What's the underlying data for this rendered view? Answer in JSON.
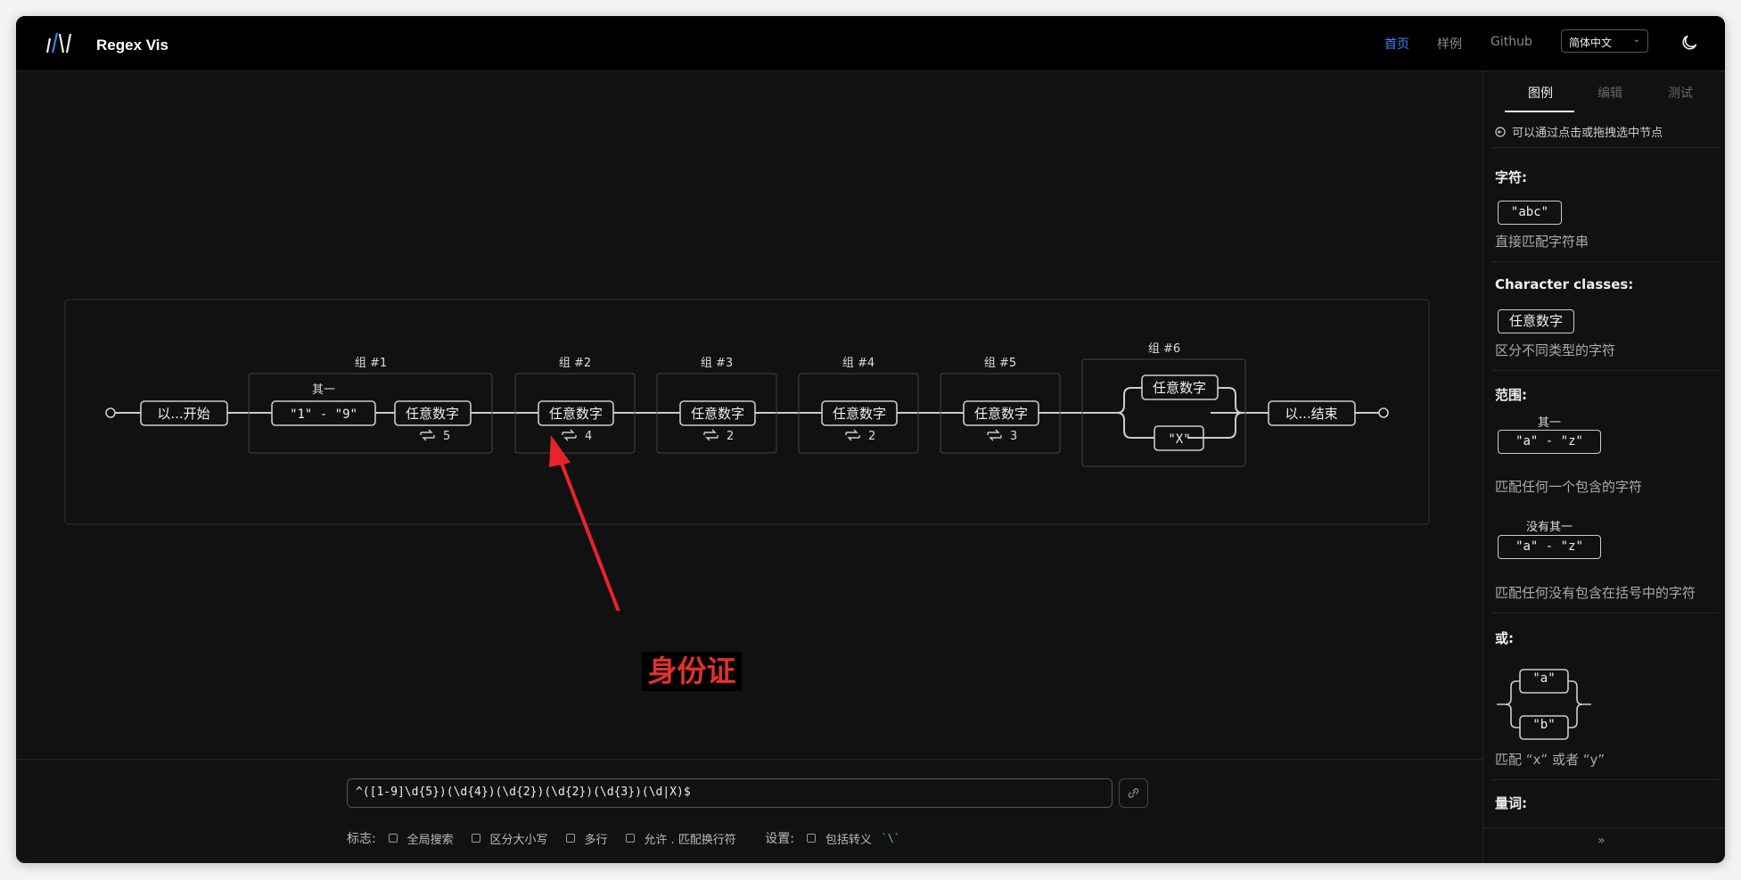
{
  "header": {
    "app_title": "Regex Vis",
    "nav": [
      {
        "label": "首页"
      },
      {
        "label": "样例"
      },
      {
        "label": "Github"
      }
    ],
    "language": "简体中文"
  },
  "diagram": {
    "start_label": "以...开始",
    "end_label": "以...结束",
    "groups": [
      {
        "label": "组 #1",
        "range_caption": "其一",
        "range": "\"1\" - \"9\"",
        "node": "任意数字",
        "quantifier": "5"
      },
      {
        "label": "组 #2",
        "node": "任意数字",
        "quantifier": "4"
      },
      {
        "label": "组 #3",
        "node": "任意数字",
        "quantifier": "2"
      },
      {
        "label": "组 #4",
        "node": "任意数字",
        "quantifier": "2"
      },
      {
        "label": "组 #5",
        "node": "任意数字",
        "quantifier": "3"
      },
      {
        "label": "组 #6",
        "alt_top": "任意数字",
        "alt_bottom": "\"X\""
      }
    ]
  },
  "annotation": {
    "text": "身份证"
  },
  "regex": {
    "value": "^([1-9]\\d{5})(\\d{4})(\\d{2})(\\d{2})(\\d{3})(\\d|X)$"
  },
  "flags": {
    "label": "标志:",
    "items": [
      {
        "label": "全局搜索"
      },
      {
        "label": "区分大小写"
      },
      {
        "label": "多行"
      },
      {
        "label": "允许 . 匹配换行符"
      }
    ]
  },
  "settings": {
    "label": "设置:",
    "escape_label": "包括转义",
    "escape_code": "`\\`"
  },
  "sidebar": {
    "tabs": [
      {
        "label": "图例"
      },
      {
        "label": "编辑"
      },
      {
        "label": "测试"
      }
    ],
    "hint": "可以通过点击或拖拽选中节点",
    "sections": {
      "chars": {
        "title": "字符:",
        "example": "\"abc\"",
        "desc": "直接匹配字符串"
      },
      "classes": {
        "title": "Character classes:",
        "example": "任意数字",
        "desc": "区分不同类型的字符"
      },
      "range": {
        "title": "范围:",
        "caption1": "其一",
        "example1": "\"a\" - \"z\"",
        "desc1": "匹配任何一个包含的字符",
        "caption2": "没有其一",
        "example2": "\"a\" - \"z\"",
        "desc2": "匹配任何没有包含在括号中的字符"
      },
      "or": {
        "title": "或:",
        "top": "\"a\"",
        "bottom": "\"b\"",
        "desc": "匹配 “x” 或者 “y”"
      },
      "quant": {
        "title": "量词:"
      }
    },
    "collapse": "»"
  }
}
